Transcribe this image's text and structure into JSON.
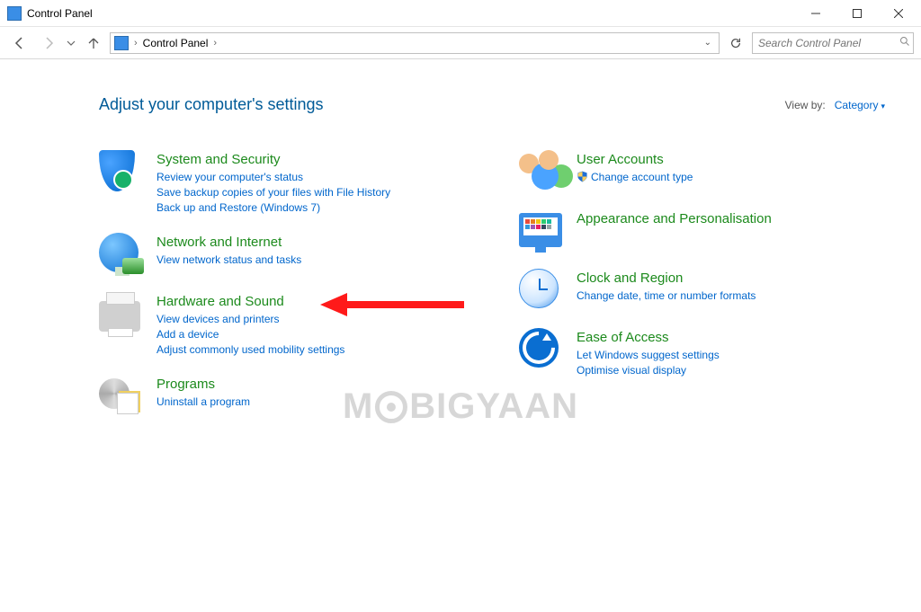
{
  "window": {
    "title": "Control Panel"
  },
  "address": {
    "crumb": "Control Panel",
    "search_placeholder": "Search Control Panel"
  },
  "heading": "Adjust your computer's settings",
  "viewby": {
    "label": "View by:",
    "value": "Category"
  },
  "left_categories": [
    {
      "title": "System and Security",
      "links": [
        "Review your computer's status",
        "Save backup copies of your files with File History",
        "Back up and Restore (Windows 7)"
      ]
    },
    {
      "title": "Network and Internet",
      "links": [
        "View network status and tasks"
      ]
    },
    {
      "title": "Hardware and Sound",
      "links": [
        "View devices and printers",
        "Add a device",
        "Adjust commonly used mobility settings"
      ]
    },
    {
      "title": "Programs",
      "links": [
        "Uninstall a program"
      ]
    }
  ],
  "right_categories": [
    {
      "title": "User Accounts",
      "links": [
        "Change account type"
      ],
      "shield_on_first": true
    },
    {
      "title": "Appearance and Personalisation",
      "links": []
    },
    {
      "title": "Clock and Region",
      "links": [
        "Change date, time or number formats"
      ]
    },
    {
      "title": "Ease of Access",
      "links": [
        "Let Windows suggest settings",
        "Optimise visual display"
      ]
    }
  ],
  "watermark": {
    "prefix": "M",
    "suffix": "BIGYAAN"
  }
}
